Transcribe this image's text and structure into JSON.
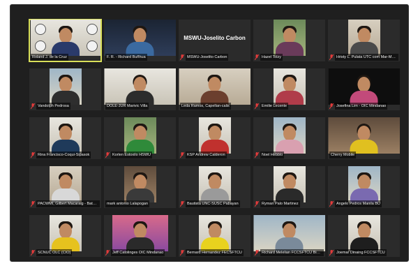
{
  "colors": {
    "window_bg": "#1f1f1f",
    "tile_bg": "#2b2b2b",
    "active_speaker_border": "#d9e05a",
    "muted_icon": "#e23b3b",
    "label_text": "#f0f0f0"
  },
  "participants": [
    {
      "name": "Roland J. de la Cruz",
      "muted": false,
      "active": true
    },
    {
      "name": "F. R. - Richard Buñhua",
      "muted": false,
      "active": false
    },
    {
      "name": "MSWU-Joselito Carbon",
      "muted": true,
      "active": false,
      "video": false
    },
    {
      "name": "Hazel Tolzy",
      "muted": true,
      "active": false
    },
    {
      "name": "Hristy L. Pulata UTC com Mar-Muyot",
      "muted": true,
      "active": false
    },
    {
      "name": "Vandolph Pedrosa",
      "muted": true,
      "active": false
    },
    {
      "name": "DOLE-JUR Marivic Villa",
      "muted": false,
      "active": false
    },
    {
      "name": "Leda Ramos, Capellan-calis",
      "muted": false,
      "active": false
    },
    {
      "name": "Emilie Lecente",
      "muted": true,
      "active": false
    },
    {
      "name": "Josefina Lim - OIC Mindanao",
      "muted": true,
      "active": false
    },
    {
      "name": "Rina Francisco-Coqui-Sipasok",
      "muted": true,
      "active": false
    },
    {
      "name": "Korlen Estoxilo HSWU",
      "muted": true,
      "active": false
    },
    {
      "name": "KSP Andrew Calderon",
      "muted": true,
      "active": false
    },
    {
      "name": "Noel Hebblo",
      "muted": true,
      "active": false
    },
    {
      "name": "Cherry Mobile",
      "muted": false,
      "active": false
    },
    {
      "name": "PACWMI, Gilbert Macaraig - Batangas",
      "muted": true,
      "active": false
    },
    {
      "name": "mark antonio Lalapogan",
      "muted": false,
      "active": false
    },
    {
      "name": "Bautista UNC-SUSC Pabayan",
      "muted": true,
      "active": false
    },
    {
      "name": "Ryman Palo Martinez",
      "muted": true,
      "active": false
    },
    {
      "name": "Angelo Pedros Manila BU",
      "muted": true,
      "active": false
    },
    {
      "name": "SCNUC OLC (CIO)",
      "muted": true,
      "active": false
    },
    {
      "name": "Jeff Catolinges OIC Mindanao",
      "muted": true,
      "active": false
    },
    {
      "name": "Bernard Hernandez FECSFTCU",
      "muted": true,
      "active": false
    },
    {
      "name": "Richard Melelian FCCSFTCU Binali",
      "muted": true,
      "active": false
    },
    {
      "name": "Joemar Dinaing FCCSFTCU",
      "muted": true,
      "active": false
    }
  ]
}
